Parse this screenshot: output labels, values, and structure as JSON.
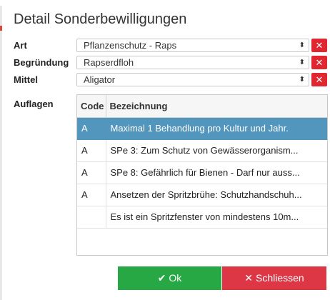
{
  "dialog": {
    "title": "Detail Sonderbewilligungen"
  },
  "fields": {
    "art": {
      "label": "Art",
      "value": "Pflanzenschutz - Raps"
    },
    "begruendung": {
      "label": "Begründung",
      "value": "Rapserdfloh"
    },
    "mittel": {
      "label": "Mittel",
      "value": "Aligator"
    },
    "clear_glyph": "✕",
    "select_arrows": "⬍"
  },
  "auflagen": {
    "label": "Auflagen",
    "columns": {
      "code": "Code",
      "bezeichnung": "Bezeichnung"
    },
    "rows": [
      {
        "code": "A",
        "bezeichnung": "Maximal 1 Behandlung pro Kultur und Jahr.",
        "selected": true
      },
      {
        "code": "A",
        "bezeichnung": "SPe 3: Zum Schutz von Gewässerorganism...",
        "selected": false
      },
      {
        "code": "A",
        "bezeichnung": "SPe 8: Gefährlich für Bienen - Darf nur auss...",
        "selected": false
      },
      {
        "code": "A",
        "bezeichnung": "Ansetzen der Spritzbrühe: Schutzhandschuh...",
        "selected": false
      },
      {
        "code": "",
        "bezeichnung": "Es ist ein Spritzfenster von mindestens 10m...",
        "selected": false
      }
    ]
  },
  "buttons": {
    "ok": {
      "label": "Ok",
      "icon": "✔"
    },
    "close": {
      "label": "Schliessen",
      "icon": "✕"
    }
  },
  "colors": {
    "ok": "#27a844",
    "close": "#dd3645",
    "clear": "#e0262f",
    "selected_row": "#5396bd"
  }
}
